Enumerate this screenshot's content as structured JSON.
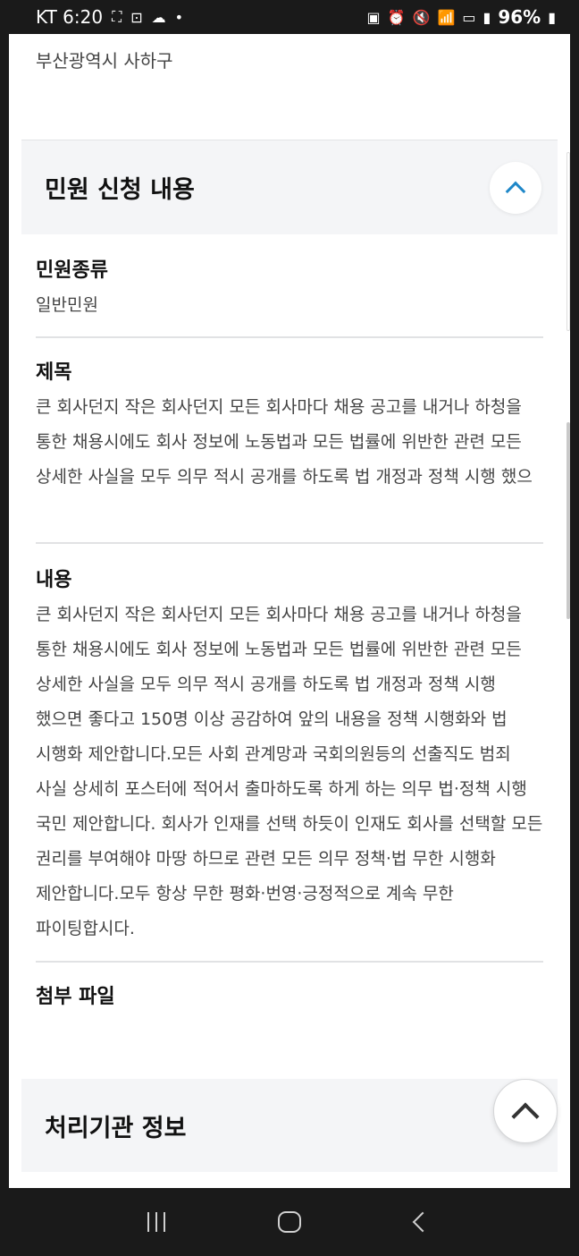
{
  "status_bar": {
    "carrier_time": "KT 6:20",
    "icons_left": [
      "screenshot-icon",
      "capture-icon",
      "cloud-icon",
      "dot-icon"
    ],
    "icons_right": [
      "nfc-icon",
      "alarm-icon",
      "mute-icon",
      "wifi-icon",
      "hd-icon",
      "signal-icon"
    ],
    "battery": "96%"
  },
  "address": {
    "text": "부산광역시 사하구"
  },
  "apply_section": {
    "title": "민원 신청 내용",
    "fields": {
      "kind": {
        "label": "민원종류",
        "value": "일반민원"
      },
      "title": {
        "label": "제목",
        "value": "큰 회사던지 작은 회사던지 모든 회사마다 채용 공고를 내거나 하청을 통한 채용시에도 회사 정보에 노동법과 모든 법률에 위반한 관련 모든 상세한 사실을 모두 의무 적시 공개를 하도록 법 개정과 정책 시행 했으"
      },
      "content": {
        "label": "내용",
        "value": "큰 회사던지 작은 회사던지 모든 회사마다 채용 공고를 내거나 하청을 통한 채용시에도 회사 정보에 노동법과 모든 법률에 위반한 관련 모든 상세한 사실을 모두 의무 적시 공개를 하도록 법 개정과 정책 시행 했으면 좋다고 150명 이상 공감하여 앞의 내용을 정책 시행화와 법 시행화 제안합니다.모든 사회 관계망과 국회의원등의 선출직도 범죄 사실 상세히 포스터에 적어서 출마하도록 하게 하는 의무 법·정책 시행 국민 제안합니다. 회사가 인재를 선택 하듯이 인재도 회사를 선택할 모든 권리를 부여해야 마땅 하므로 관련 모든 의무 정책·법 무한 시행화 제안합니다.모두 항상 무한 평화·번영·긍정적으로 계속 무한 파이팅합시다."
      },
      "attachment": {
        "label": "첨부 파일"
      }
    }
  },
  "org_section": {
    "title": "처리기관 정보"
  }
}
